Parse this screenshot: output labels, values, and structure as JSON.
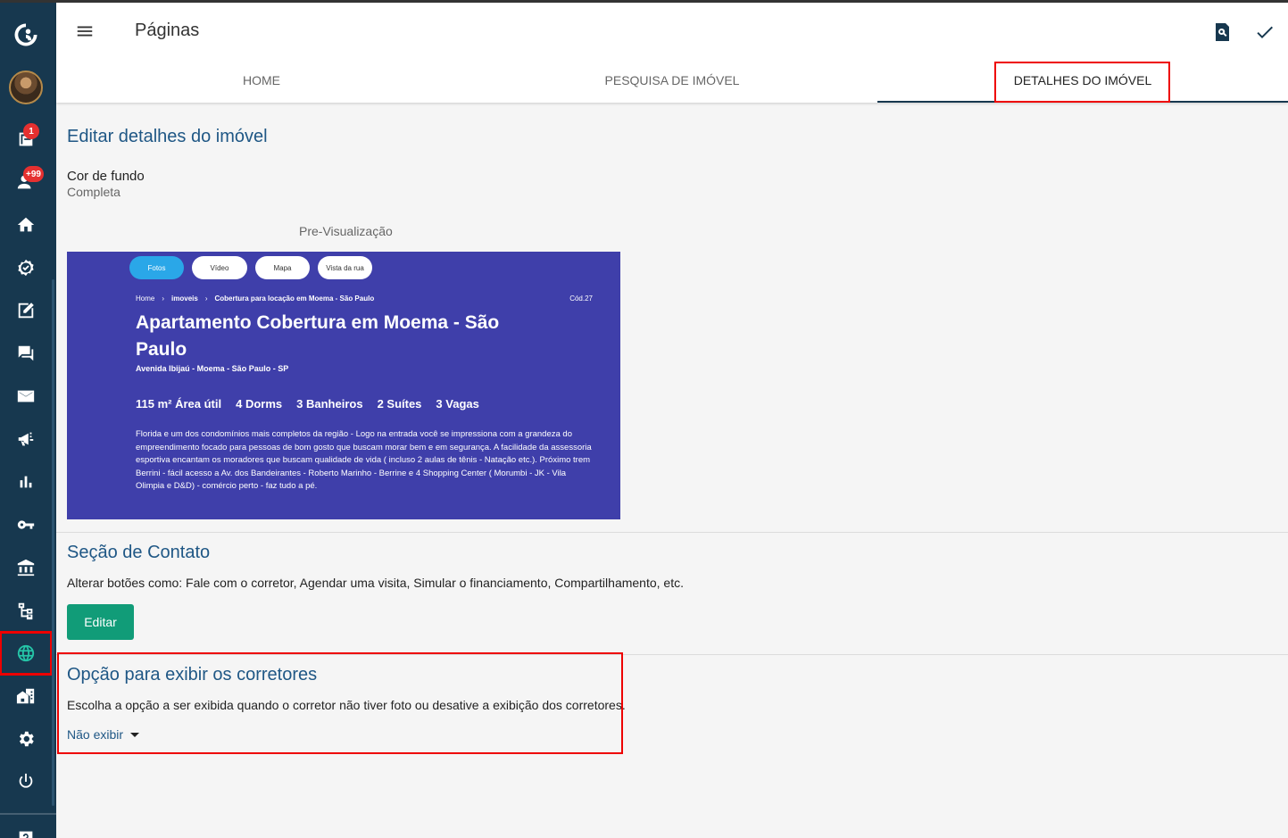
{
  "header": {
    "title": "Páginas",
    "tabs": [
      {
        "label": "HOME",
        "active": false
      },
      {
        "label": "PESQUISA DE IMÓVEL",
        "active": false
      },
      {
        "label": "DETALHES DO IMÓVEL",
        "active": true
      }
    ],
    "icons": [
      "preview-search-icon",
      "check-icon"
    ]
  },
  "sidebar": {
    "badges": {
      "notifications": "1",
      "leads": "+99"
    },
    "items": [
      "logo-icon",
      "avatar",
      "notifications-icon",
      "leads-icon",
      "home-icon",
      "verified-icon",
      "edit-note-icon",
      "chat-icon",
      "mail-icon",
      "megaphone-icon",
      "chart-icon",
      "key-icon",
      "bank-icon",
      "sitemap-icon",
      "globe-icon",
      "buildings-icon",
      "gear-icon",
      "power-icon",
      "help-icon"
    ],
    "active_item": "globe-icon"
  },
  "details": {
    "title": "Editar detalhes do imóvel",
    "background_label": "Cor de fundo",
    "background_value": "Completa",
    "preview_label": "Pre-Visualização"
  },
  "preview": {
    "pills": [
      "Fotos",
      "Vídeo",
      "Mapa",
      "Vista da rua"
    ],
    "breadcrumb": [
      "Home",
      "›",
      "imoveis",
      "›",
      "Cobertura para locação em Moema - São Paulo"
    ],
    "code": "Cód.27",
    "title": "Apartamento Cobertura em Moema - São Paulo",
    "address": "Avenida Ibijaú - Moema - São Paulo - SP",
    "features": [
      "115 m² Área útil",
      "4 Dorms",
      "3 Banheiros",
      "2 Suítes",
      "3 Vagas"
    ],
    "description": "Florida e um dos condomínios mais completos da região - Logo na entrada você se impressiona com a grandeza do empreendimento focado para pessoas de bom gosto que buscam morar bem e em segurança. A facilidade da assessoria esportiva encantam os moradores que buscam qualidade de vida ( incluso 2 aulas de tênis - Natação etc.). Próximo trem Berrini - fácil acesso a Av. dos Bandeirantes - Roberto Marinho - Berrine e 4 Shopping Center ( Morumbi - JK - Vila Olimpia e D&D) - comércio perto - faz tudo a pé.",
    "background_color": "#3f3faa",
    "active_pill_color": "#2aa7e8"
  },
  "contact": {
    "title": "Seção de Contato",
    "description": "Alterar botões como: Fale com o corretor, Agendar uma visita, Simular o financiamento, Compartilhamento, etc.",
    "edit_label": "Editar"
  },
  "brokers": {
    "title": "Opção para exibir os corretores",
    "description": "Escolha a opção a ser exibida quando o corretor não tiver foto ou desative a exibição dos corretores.",
    "selected": "Não exibir"
  },
  "colors": {
    "sidebar": "#17384f",
    "accent": "#1f5785",
    "button": "#119c78",
    "highlight": "#ee0000"
  }
}
